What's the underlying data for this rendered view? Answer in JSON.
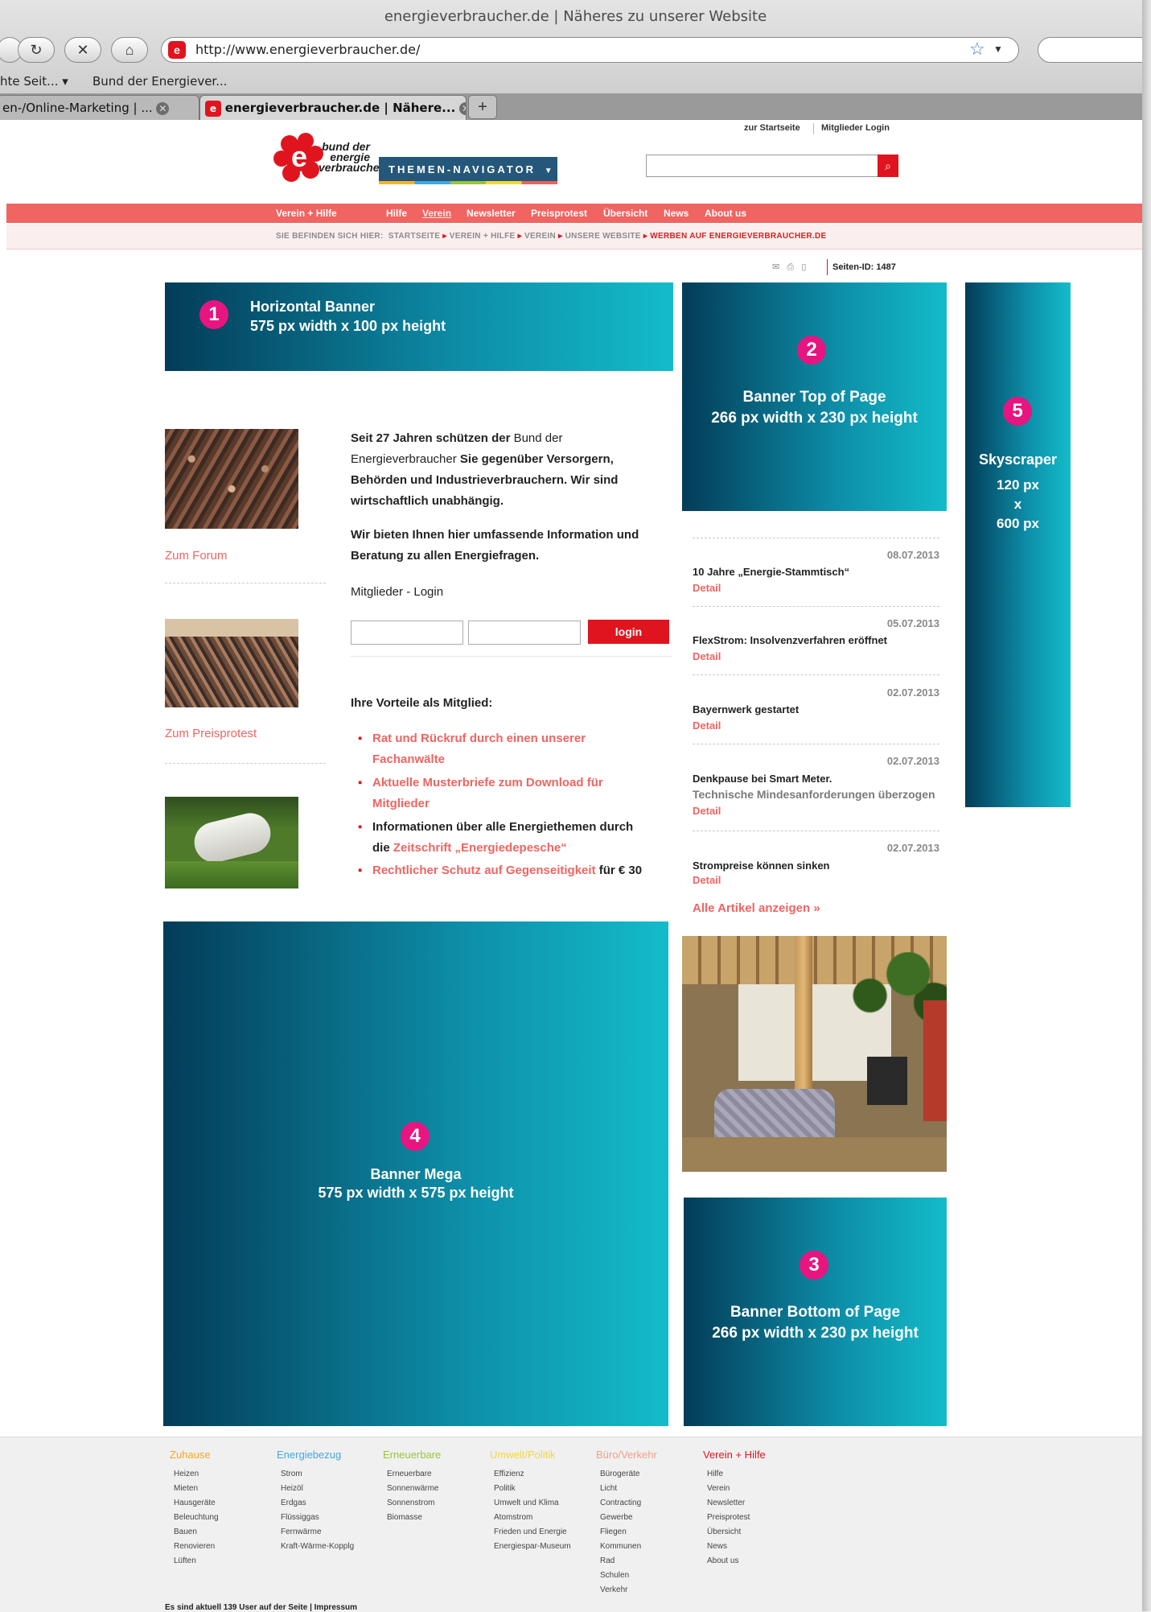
{
  "browser": {
    "window_title": "energieverbraucher.de | Näheres zu unserer Website",
    "url": "http://www.energieverbraucher.de/",
    "bookmarks": [
      "hte Seit... ▾",
      "Bund der Energiever..."
    ],
    "tabs": [
      {
        "title": "en-/Online-Marketing | ..."
      },
      {
        "title": "energieverbraucher.de | Nähere..."
      }
    ]
  },
  "header": {
    "links": [
      "zur Startseite",
      "Mitglieder Login"
    ],
    "logo_text": "bund der energie verbraucher",
    "themen_navigator": "THEMEN-NAVIGATOR",
    "search_placeholder": ""
  },
  "nav": {
    "items": [
      "Verein + Hilfe",
      "Hilfe",
      "Verein",
      "Newsletter",
      "Preisprotest",
      "Übersicht",
      "News",
      "About us"
    ]
  },
  "breadcrumb": {
    "prefix": "SIE BEFINDEN SICH HIER:",
    "items": [
      "STARTSEITE",
      "VEREIN + HILFE",
      "VEREIN",
      "UNSERE WEBSITE"
    ],
    "current": "WERBEN AUF ENERGIEVERBRAUCHER.DE"
  },
  "page_id": "Seiten-ID: 1487",
  "banners": {
    "horizontal": {
      "number": "1",
      "title": "Horizontal Banner",
      "size": "575 px width x 100 px height"
    },
    "top": {
      "number": "2",
      "title": "Banner Top of Page",
      "size": "266 px width x 230 px height"
    },
    "bottom": {
      "number": "3",
      "title": "Banner Bottom of Page",
      "size": "266 px width x 230 px height"
    },
    "mega": {
      "number": "4",
      "title": "Banner Mega",
      "size": "575 px width x 575 px height"
    },
    "skyscraper": {
      "number": "5",
      "title": "Skyscraper",
      "w": "120 px",
      "x": "x",
      "h": "600 px"
    }
  },
  "sidebar": {
    "links": [
      "Zum Forum",
      "Zum Preisprotest"
    ]
  },
  "intro": {
    "p1_a": "Seit 27 Jahren schützen der ",
    "p1_b": "Bund der Energieverbraucher",
    "p1_c": " Sie gegenüber Versorgern, Behörden und Industrieverbrauchern. Wir sind wirtschaftlich unabhängig.",
    "p2": "Wir bieten Ihnen hier umfassende Information und Beratung zu allen Energiefragen.",
    "login_heading": "Mitglieder - Login",
    "login_button": "login",
    "benefits_heading": "Ihre Vorteile als Mitglied:",
    "benefits": [
      "Rat und Rückruf durch einen unserer Fachanwälte",
      "Aktuelle Musterbriefe zum Download für Mitglieder",
      "Informationen über alle Energiethemen durch die ",
      "Rechtlicher Schutz auf Gegenseitigkeit"
    ],
    "benefit3_link": "Zeitschrift „Energiedepesche“",
    "benefit4_suffix": " für € 30"
  },
  "news": {
    "items": [
      {
        "date": "08.07.2013",
        "title": "10 Jahre „Energie-Stammtisch“",
        "detail": "Detail"
      },
      {
        "date": "05.07.2013",
        "title": "FlexStrom: Insolvenzverfahren eröffnet",
        "detail": "Detail"
      },
      {
        "date": "02.07.2013",
        "title": "Bayernwerk gestartet",
        "detail": "Detail"
      },
      {
        "date": "02.07.2013",
        "title": "Denkpause bei Smart Meter.",
        "subtitle": "Technische Mindesanforderungen überzogen",
        "detail": "Detail"
      },
      {
        "date": "02.07.2013",
        "title": "Strompreise können sinken",
        "detail": "Detail"
      }
    ],
    "all_link": "Alle Artikel anzeigen »"
  },
  "footer": {
    "columns": [
      {
        "title": "Zuhause",
        "color": "#f5a623",
        "links": [
          "Heizen",
          "Mieten",
          "Hausgeräte",
          "Beleuchtung",
          "Bauen",
          "Renovieren",
          "Lüften"
        ]
      },
      {
        "title": "Energiebezug",
        "color": "#42a9e0",
        "links": [
          "Strom",
          "Heizöl",
          "Erdgas",
          "Flüssiggas",
          "Fernwärme",
          "Kraft-Wärme-Kopplg"
        ]
      },
      {
        "title": "Erneuerbare",
        "color": "#98c43a",
        "links": [
          "Erneuerbare",
          "Sonnenwärme",
          "Sonnenstrom",
          "Biomasse"
        ]
      },
      {
        "title": "Umwelt/Politik",
        "color": "#f2d83b",
        "links": [
          "Effizienz",
          "Politik",
          "Umwelt und Klima",
          "Atomstrom",
          "Frieden und Energie",
          "Energiespar-Museum"
        ]
      },
      {
        "title": "Büro/Verkehr",
        "color": "#f0a08a",
        "links": [
          "Bürogeräte",
          "Licht",
          "Contracting",
          "Gewerbe",
          "Fliegen",
          "Kommunen",
          "Rad",
          "Schulen",
          "Verkehr"
        ]
      },
      {
        "title": "Verein + Hilfe",
        "color": "#e0141e",
        "links": [
          "Hilfe",
          "Verein",
          "Newsletter",
          "Preisprotest",
          "Übersicht",
          "News",
          "About us"
        ]
      }
    ],
    "note": "Es sind aktuell 139 User auf der Seite  |  Impressum"
  },
  "colors": {
    "brand_red": "#e0141e",
    "nav_red": "#f06461",
    "banner_dark": "#033c58",
    "banner_light": "#13bcca",
    "badge_pink": "#e8147f"
  }
}
